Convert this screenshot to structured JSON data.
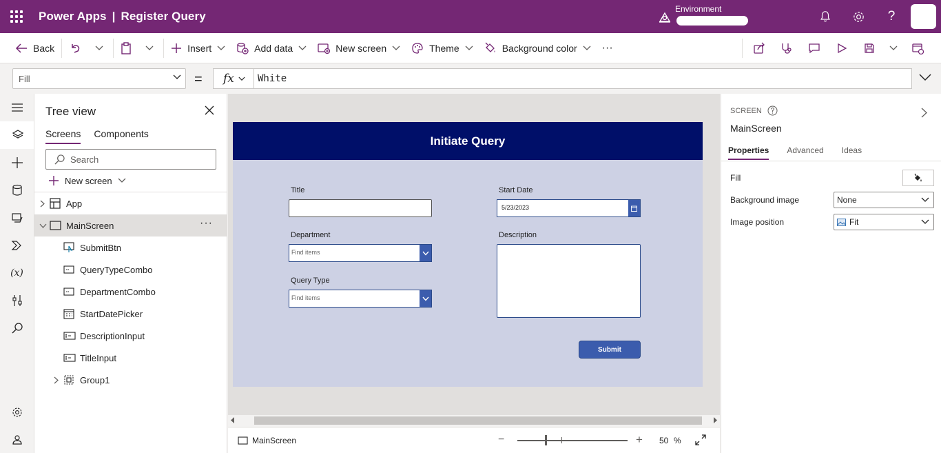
{
  "header": {
    "brand": "Power Apps",
    "separator": "|",
    "app_name": "Register Query",
    "environment_label": "Environment"
  },
  "toolbar": {
    "back": "Back",
    "insert": "Insert",
    "add_data": "Add data",
    "new_screen": "New screen",
    "theme": "Theme",
    "background_color": "Background color",
    "more": "···"
  },
  "formula_bar": {
    "property": "Fill",
    "equals": "=",
    "fx": "fx",
    "formula": "White"
  },
  "tree_view": {
    "title": "Tree view",
    "tabs": [
      "Screens",
      "Components"
    ],
    "search_placeholder": "Search",
    "new_screen": "New screen",
    "nodes": {
      "app": "App",
      "main_screen": "MainScreen",
      "submit_btn": "SubmitBtn",
      "query_type_combo": "QueryTypeCombo",
      "department_combo": "DepartmentCombo",
      "start_date_picker": "StartDatePicker",
      "description_input": "DescriptionInput",
      "title_input": "TitleInput",
      "group1": "Group1"
    },
    "more": "···"
  },
  "canvas": {
    "header_title": "Initiate Query",
    "title_label": "Title",
    "start_date_label": "Start Date",
    "start_date_value": "5/23/2023",
    "department_label": "Department",
    "department_placeholder": "Find items",
    "description_label": "Description",
    "query_type_label": "Query Type",
    "query_type_placeholder": "Find items",
    "submit_label": "Submit",
    "colors": {
      "header_bg": "#000f69",
      "screen_bg": "#cdd1e4",
      "button_bg": "#3b5cad"
    }
  },
  "status_bar": {
    "screen_name": "MainScreen",
    "zoom_value": "50",
    "zoom_unit": "%",
    "zoom_minus": "−",
    "zoom_plus": "+"
  },
  "properties": {
    "kind": "SCREEN",
    "name": "MainScreen",
    "tabs": [
      "Properties",
      "Advanced",
      "Ideas"
    ],
    "fill_label": "Fill",
    "background_image_label": "Background image",
    "background_image_value": "None",
    "image_position_label": "Image position",
    "image_position_value": "Fit"
  },
  "theme": {
    "accent": "#742774"
  }
}
